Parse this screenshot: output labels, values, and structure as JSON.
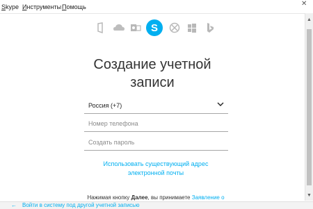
{
  "menu": {
    "items": [
      {
        "first": "S",
        "rest": "kype"
      },
      {
        "first": "И",
        "rest": "нструменты"
      },
      {
        "first": "П",
        "rest": "омощь"
      }
    ]
  },
  "app_icons": [
    "office-icon",
    "onedrive-icon",
    "outlook-icon",
    "skype-icon",
    "xbox-icon",
    "windows-icon",
    "bing-icon"
  ],
  "skype_letter": "S",
  "colors": {
    "accent": "#00aff0",
    "scroll_thumb": "#c1c1c1"
  },
  "form": {
    "title_line1": "Создание учетной",
    "title_line2": "записи",
    "country_value": "Россия (+7)",
    "phone_placeholder": "Номер телефона",
    "password_placeholder": "Создать пароль",
    "alt_link_line1": "Использовать существующий адрес",
    "alt_link_line2": "электронной почты",
    "footnote_before": "Нажимая кнопку",
    "footnote_bold": "Далее",
    "footnote_after": ", вы принимаете",
    "footnote_link": "Заявление о"
  },
  "bottom": {
    "link": "Войти в систему под другой учетной записью"
  }
}
